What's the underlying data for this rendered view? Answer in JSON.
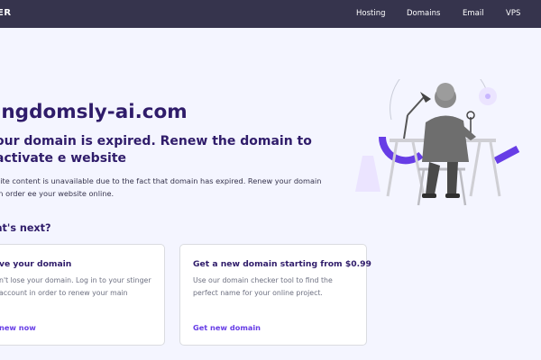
{
  "header": {
    "brand": "ER",
    "nav": [
      "Hosting",
      "Domains",
      "Email",
      "VPS"
    ]
  },
  "main": {
    "domain": "ingdomsly-ai.com",
    "headline": "our domain is expired. Renew the domain to activate e website",
    "description": "site content is unavailable due to the fact that domain has expired. Renew your domain in order ee your website online.",
    "whats_next": "at's next?"
  },
  "cards": [
    {
      "title": "ve your domain",
      "text": "n't lose your domain. Log in to your stinger account in order to renew your main",
      "link": "new now"
    },
    {
      "title": "Get a new domain starting from $0.99",
      "text": "Use our domain checker tool to find the perfect name for your online project.",
      "link": "Get new domain"
    }
  ],
  "illustration": {
    "icon": "person-at-desk-illustration"
  },
  "colors": {
    "header_bg": "#36344d",
    "page_bg": "#f4f5ff",
    "heading": "#2f1c6a",
    "accent": "#673de6",
    "accent_light": "#ebe4ff"
  }
}
